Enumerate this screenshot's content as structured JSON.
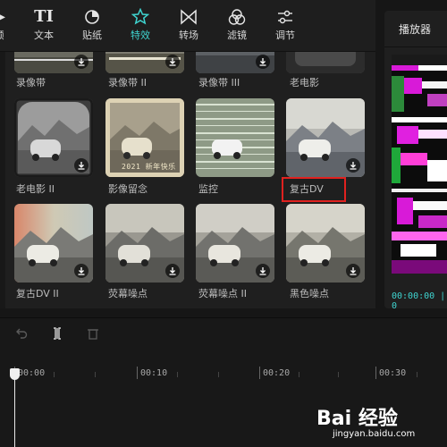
{
  "toolbar": {
    "items": [
      {
        "label": "频",
        "icon": "media-icon",
        "active": false
      },
      {
        "label": "文本",
        "icon": "text-icon",
        "active": false
      },
      {
        "label": "贴纸",
        "icon": "sticker-icon",
        "active": false
      },
      {
        "label": "特效",
        "icon": "effects-star-icon",
        "active": true
      },
      {
        "label": "转场",
        "icon": "transition-icon",
        "active": false
      },
      {
        "label": "滤镜",
        "icon": "filter-icon",
        "active": false
      },
      {
        "label": "调节",
        "icon": "adjust-sliders-icon",
        "active": false
      }
    ],
    "text_icon_glyph": "TI"
  },
  "effects": {
    "top_row": [
      "录像带",
      "录像带 II",
      "录像带 III",
      "老电影"
    ],
    "cards": [
      {
        "label": "老电影 II"
      },
      {
        "label": "影像留念",
        "stamp": "2021 新年快乐"
      },
      {
        "label": "监控"
      },
      {
        "label": "复古DV",
        "selected": true
      },
      {
        "label": "复古DV II"
      },
      {
        "label": "荧幕噪点"
      },
      {
        "label": "荧幕噪点 II"
      },
      {
        "label": "黑色噪点"
      }
    ]
  },
  "player": {
    "title": "播放器",
    "timecode": "00:00:00 | 0"
  },
  "timeline": {
    "tools": [
      "undo-icon",
      "split-icon",
      "delete-icon"
    ],
    "marks": [
      "00:00",
      "00:10",
      "00:20",
      "00:30"
    ]
  },
  "watermark": {
    "logo": "Bai 经验",
    "url": "jingyan.baidu.com"
  },
  "colors": {
    "accent": "#3fd4d0",
    "selection": "#e0211f",
    "background": "#161616"
  }
}
